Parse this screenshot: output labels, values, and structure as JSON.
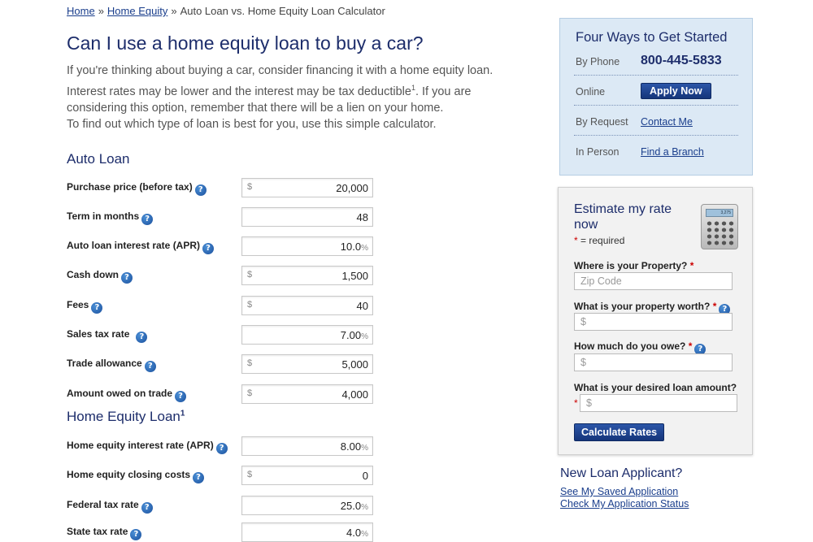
{
  "breadcrumb": {
    "home": "Home",
    "sep1": "»",
    "equity": "Home Equity",
    "sep2": "»",
    "current": "Auto Loan vs. Home Equity Loan Calculator"
  },
  "main": {
    "title": "Can I use a home equity loan to buy a car?",
    "intro_a": "If you're thinking about buying a car, consider financing it with a home equity loan. Interest rates may be lower and the interest may be tax deductible",
    "intro_sup": "1",
    "intro_b": ". If you are considering this option, remember that there will be a lien on your home.",
    "intro2": "To find out which type of loan is best for you, use this simple calculator."
  },
  "auto_loan": {
    "title": "Auto Loan",
    "fields": [
      {
        "label": "Purchase price (before tax)",
        "prefix": "$",
        "value": "20,000",
        "suffix": ""
      },
      {
        "label": "Term in months",
        "prefix": "",
        "value": "48",
        "suffix": ""
      },
      {
        "label": "Auto loan interest rate (APR)",
        "prefix": "",
        "value": "10.0",
        "suffix": "%"
      },
      {
        "label": "Cash down",
        "prefix": "$",
        "value": "1,500",
        "suffix": ""
      },
      {
        "label": "Fees",
        "prefix": "$",
        "value": "40",
        "suffix": ""
      },
      {
        "label": "Sales tax rate",
        "prefix": "",
        "value": "7.00",
        "suffix": "%"
      },
      {
        "label": "Trade allowance",
        "prefix": "$",
        "value": "5,000",
        "suffix": ""
      },
      {
        "label": "Amount owed on trade",
        "prefix": "$",
        "value": "4,000",
        "suffix": ""
      }
    ]
  },
  "home_equity": {
    "title": "Home Equity Loan",
    "title_sup": "1",
    "fields": [
      {
        "label": "Home equity interest rate (APR)",
        "prefix": "",
        "value": "8.00",
        "suffix": "%"
      },
      {
        "label": "Home equity closing costs",
        "prefix": "$",
        "value": "0",
        "suffix": ""
      },
      {
        "label": "Federal tax rate",
        "prefix": "",
        "value": "25.0",
        "suffix": "%"
      },
      {
        "label": "State tax rate",
        "prefix": "",
        "value": "4.0",
        "suffix": "%"
      }
    ]
  },
  "help_glyph": "?",
  "four_ways": {
    "title": "Four Ways to Get Started",
    "phone_label": "By Phone",
    "phone": "800-445-5833",
    "online_label": "Online",
    "apply": "Apply Now",
    "request_label": "By Request",
    "contact": "Contact Me",
    "person_label": "In Person",
    "branch": "Find a Branch"
  },
  "estimate": {
    "title": "Estimate my rate now",
    "required_star": "*",
    "required_note": " = required",
    "calc_display": "3,275",
    "property_q": "Where is your Property?",
    "zip_placeholder": "Zip Code",
    "worth_q": "What is your property worth?",
    "owe_q": "How much do you owe?",
    "desired_q": "What is your desired loan amount?",
    "dollar": "$",
    "button": "Calculate Rates"
  },
  "new_loan": {
    "title": "New Loan Applicant?",
    "saved": "See My Saved Application",
    "status": "Check My Application Status"
  },
  "colors": {
    "navy": "#1d2d6b",
    "link": "#1a3e8c",
    "panel": "#dce9f5",
    "required": "#cc0000"
  }
}
